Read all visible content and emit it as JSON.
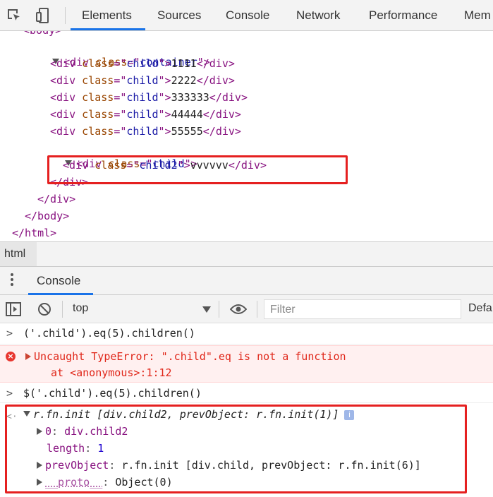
{
  "tabs": [
    "Elements",
    "Sources",
    "Console",
    "Network",
    "Performance",
    "Mem"
  ],
  "tree": {
    "body_open_partial": "<body>",
    "container_open": {
      "tag": "div",
      "attr": "class",
      "value": "container"
    },
    "children": [
      {
        "tag": "div",
        "attr": "class",
        "value": "child",
        "text": "1111"
      },
      {
        "tag": "div",
        "attr": "class",
        "value": "child",
        "text": "2222"
      },
      {
        "tag": "div",
        "attr": "class",
        "value": "child",
        "text": "333333"
      },
      {
        "tag": "div",
        "attr": "class",
        "value": "child",
        "text": "44444"
      },
      {
        "tag": "div",
        "attr": "class",
        "value": "child",
        "text": "55555"
      }
    ],
    "sixth_child": {
      "tag": "div",
      "attr": "class",
      "value": "child"
    },
    "child2": {
      "tag": "div",
      "attr": "class",
      "value": "child2",
      "text": "vvvvvv"
    },
    "close_div": "</div>",
    "close_body": "</body>",
    "close_html": "</html>"
  },
  "breadcrumb": "html",
  "drawer": {
    "tab": "Console"
  },
  "console_toolbar": {
    "context": "top",
    "filter_placeholder": "Filter",
    "levels": "Defa"
  },
  "console": {
    "cmd1": "('.child').eq(5).children()",
    "error_line1": "Uncaught TypeError: \".child\".eq is not a function",
    "error_line2": "at <anonymous>:1:12",
    "cmd2": "$('.child').eq(5).children()",
    "result": {
      "summary": "r.fn.init [div.child2, prevObject: r.fn.init(1)]",
      "prop0_key": "0",
      "prop0_val": "div.child2",
      "length_key": "length",
      "length_val": "1",
      "prev_key": "prevObject",
      "prev_val": "r.fn.init [div.child, prevObject: r.fn.init(6)]",
      "proto_key": "__proto__",
      "proto_val": "Object(0)"
    }
  }
}
